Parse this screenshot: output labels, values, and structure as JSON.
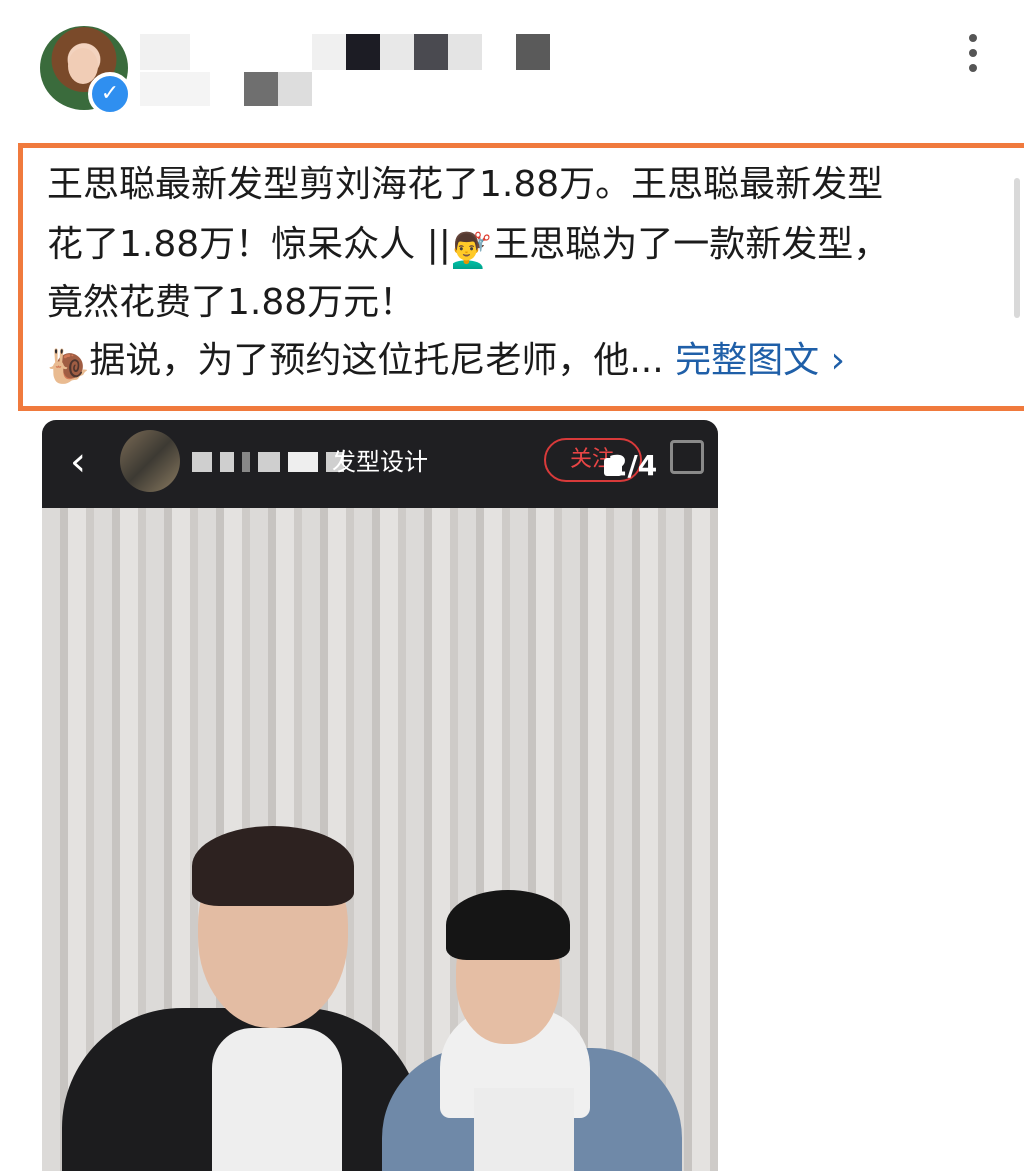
{
  "post": {
    "line1": "王思聪最新发型剪刘海花了1.88万。王思聪最新发型",
    "line2_a": "花了1.88万！惊呆众人 ||",
    "line2_emoji": "💇‍♂️",
    "line2_b": "王思聪为了一款新发型，",
    "line3": "竟然花费了1.88万元！",
    "line4_emoji": "🐌",
    "line4_text": "据说，为了预约这位托尼老师，他...",
    "full_link": "完整图文 ›"
  },
  "image_card": {
    "back_label": "‹",
    "title": "发型设计",
    "follow_label": "关注",
    "counter": "2/4"
  },
  "icons": {
    "verified": "verified-check-icon",
    "more": "more-vertical-icon",
    "back": "back-chevron-icon",
    "expand": "expand-icon"
  },
  "colors": {
    "highlight_border": "#f07a3d",
    "link": "#1f5fa8",
    "verified": "#2f8ff0",
    "follow": "#e84545"
  }
}
